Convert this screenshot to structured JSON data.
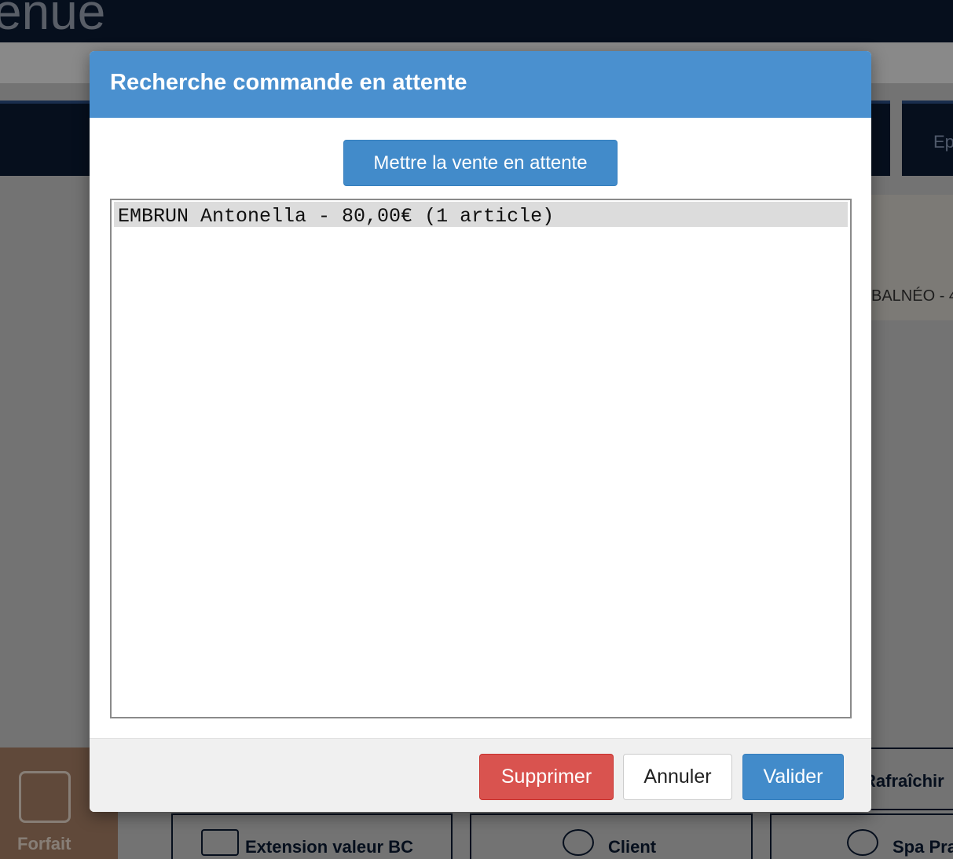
{
  "background": {
    "header_title": "enue",
    "tab_right_label": "Ep",
    "card_label": "BALNÉO - 4",
    "forfait_label": "Forfait",
    "refresh_label": "Rafraîchir",
    "extension_label": "Extension valeur BC",
    "client_label": "Client",
    "spa_label": "Spa Pra"
  },
  "modal": {
    "title": "Recherche commande en attente",
    "hold_button_label": "Mettre la vente en attente",
    "orders": [
      "EMBRUN Antonella - 80,00€ (1 article)"
    ],
    "footer": {
      "delete_label": "Supprimer",
      "cancel_label": "Annuler",
      "validate_label": "Valider"
    }
  },
  "colors": {
    "header_blue": "#4a90cf",
    "primary": "#428bca",
    "danger": "#d9534f",
    "navy": "#0b1a33"
  }
}
